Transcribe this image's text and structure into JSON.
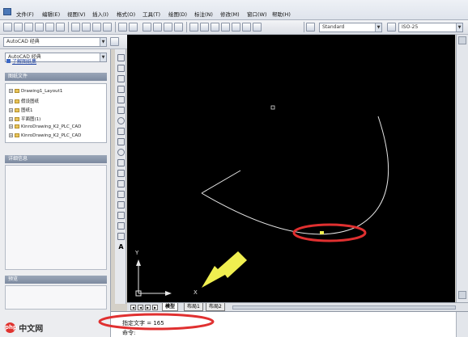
{
  "menubar": {
    "items": [
      "文件(F)",
      "编辑(E)",
      "视图(V)",
      "插入(I)",
      "格式(O)",
      "工具(T)",
      "绘图(D)",
      "标注(N)",
      "修改(M)",
      "窗口(W)",
      "帮助(H)"
    ]
  },
  "toolbar": {
    "text_style": "Standard",
    "dim_style": "ISO-25"
  },
  "left_panel": {
    "tab_label": "AutoCAD 经典",
    "link_text": "了解图纸集",
    "section_files": "图纸文件",
    "files": [
      "Drawing1_Layout1",
      "假设图纸",
      "图纸1",
      "平面图(1)",
      "KinroDrawing_K2_PLC_CAD",
      "KinroDrawing_K2_PLC_CAD"
    ],
    "section_details": "详细信息",
    "section_preview": "预览"
  },
  "layout_tabs": [
    "模型",
    "布局1",
    "布局2"
  ],
  "command": {
    "line1": "指定文字 = 165",
    "line2": "命令:"
  },
  "ucs": {
    "x_label": "X",
    "y_label": "Y"
  },
  "watermark": {
    "logo": "php",
    "text": "中文网"
  },
  "colors": {
    "canvas_bg": "#000000",
    "highlight_red": "#e03030",
    "arrow_yellow": "#f0ef50"
  }
}
